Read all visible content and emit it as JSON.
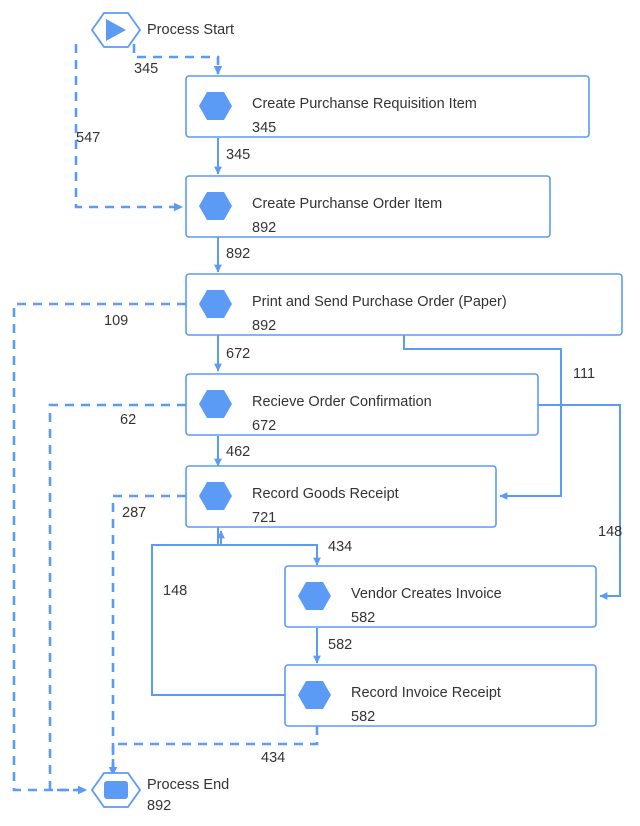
{
  "diagram": {
    "type": "process-flow-graph",
    "accent_color": "#5b9bf5",
    "text_color": "#333333",
    "background_color": "#ffffff",
    "start": {
      "label": "Process Start",
      "icon": "play-icon"
    },
    "end": {
      "label": "Process End",
      "count": "892",
      "icon": "stop-icon"
    },
    "nodes": [
      {
        "id": "n1",
        "label": "Create Purchanse Requisition Item",
        "count": "345",
        "icon": "activity-hexagon-icon"
      },
      {
        "id": "n2",
        "label": "Create Purchanse Order Item",
        "count": "892",
        "icon": "activity-hexagon-icon"
      },
      {
        "id": "n3",
        "label": "Print and Send Purchase Order (Paper)",
        "count": "892",
        "icon": "activity-hexagon-icon"
      },
      {
        "id": "n4",
        "label": "Recieve Order Confirmation",
        "count": "672",
        "icon": "activity-hexagon-icon"
      },
      {
        "id": "n5",
        "label": "Record Goods Receipt",
        "count": "721",
        "icon": "activity-hexagon-icon"
      },
      {
        "id": "n6",
        "label": "Vendor Creates Invoice",
        "count": "582",
        "icon": "activity-hexagon-icon"
      },
      {
        "id": "n7",
        "label": "Record Invoice Receipt",
        "count": "582",
        "icon": "activity-hexagon-icon"
      }
    ],
    "edges": [
      {
        "id": "e1",
        "from": "start",
        "to": "n1",
        "label": "345",
        "style": "dashed"
      },
      {
        "id": "e2",
        "from": "start",
        "to": "n2",
        "label": "547",
        "style": "dashed"
      },
      {
        "id": "e3",
        "from": "n1",
        "to": "n2",
        "label": "345",
        "style": "solid"
      },
      {
        "id": "e4",
        "from": "n2",
        "to": "n3",
        "label": "892",
        "style": "solid"
      },
      {
        "id": "e5",
        "from": "n3",
        "to": "n4",
        "label": "672",
        "style": "solid"
      },
      {
        "id": "e6",
        "from": "n3",
        "to": "n5",
        "label": "111",
        "style": "solid"
      },
      {
        "id": "e7",
        "from": "n3",
        "to": "end",
        "label": "109",
        "style": "dashed"
      },
      {
        "id": "e8",
        "from": "n4",
        "to": "n5",
        "label": "462",
        "style": "solid"
      },
      {
        "id": "e9",
        "from": "n4",
        "to": "n6",
        "label": "148",
        "style": "solid"
      },
      {
        "id": "e10",
        "from": "n4",
        "to": "end",
        "label": "62",
        "style": "dashed"
      },
      {
        "id": "e11",
        "from": "n5",
        "to": "n6",
        "label": "434",
        "style": "solid"
      },
      {
        "id": "e12",
        "from": "n5",
        "to": "end",
        "label": "287",
        "style": "dashed"
      },
      {
        "id": "e13",
        "from": "n6",
        "to": "n7",
        "label": "582",
        "style": "solid"
      },
      {
        "id": "e14",
        "from": "n7",
        "to": "n5",
        "label": "148",
        "style": "solid"
      },
      {
        "id": "e15",
        "from": "n7",
        "to": "end",
        "label": "434",
        "style": "dashed"
      }
    ]
  }
}
